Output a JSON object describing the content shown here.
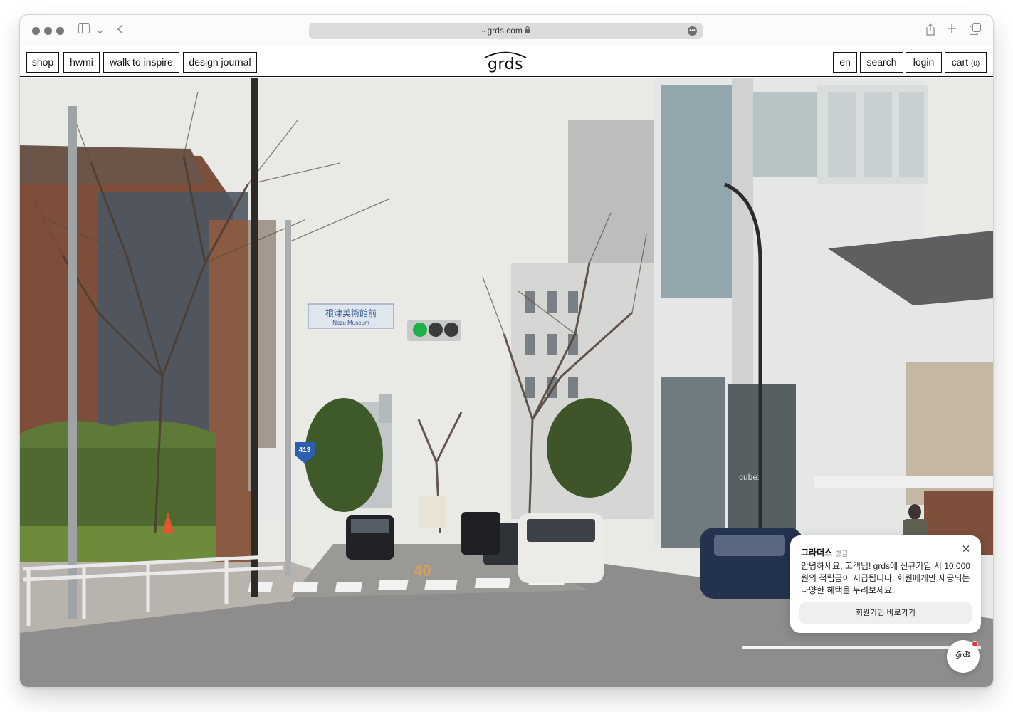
{
  "browser": {
    "url": "grds.com",
    "icons": [
      "sidebar-icon",
      "chevron-down-icon",
      "back-icon",
      "share-icon",
      "new-tab-icon",
      "tabs-icon",
      "lock-icon",
      "more-icon"
    ]
  },
  "header": {
    "nav_left": [
      "shop",
      "hwmi",
      "walk to inspire",
      "design journal"
    ],
    "logo": "grds",
    "nav_right": {
      "language": "en",
      "search": "search",
      "login": "login",
      "cart_label": "cart",
      "cart_count": "(0)"
    }
  },
  "hero": {
    "sign_text": "根津美術館前",
    "sign_subtext": "Nezu Museum",
    "route_number": "413",
    "road_marking": "40",
    "shop_text": "cubex"
  },
  "popup": {
    "title": "그라더스",
    "time": "방금",
    "body": "안녕하세요, 고객님! grds에 신규가입 시 10,000원의 적립금이 지급됩니다. 회원에게만 제공되는 다양한 혜택을 누려보세요.",
    "cta": "회원가입 바로가기"
  },
  "chat": {
    "logo": "grds",
    "has_notification": true
  },
  "colors": {
    "nav_border": "#111111",
    "notification_dot": "#e5313a",
    "popup_button_bg": "#efefef"
  }
}
